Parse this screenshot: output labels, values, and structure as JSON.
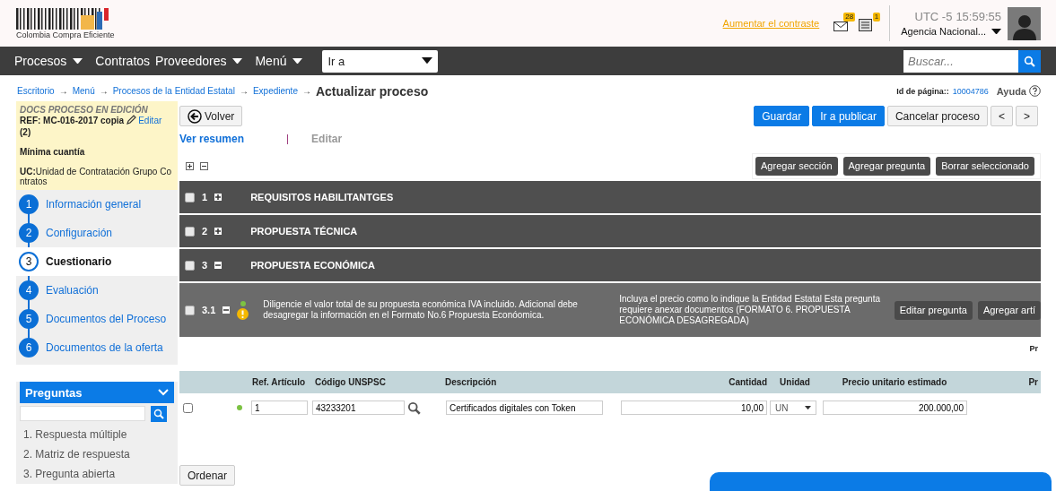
{
  "header": {
    "logo_text": "Colombia Compra Eficiente",
    "contrast_link": "Aumentar el contraste",
    "mail_count": "28",
    "news_count": "1",
    "timezone": "UTC -5",
    "time": "15:59:55",
    "agency": "Agencia Nacional..."
  },
  "nav": {
    "items": [
      {
        "label": "Procesos",
        "dropdown": true
      },
      {
        "label": "Contratos",
        "dropdown": false
      },
      {
        "label": "Proveedores",
        "dropdown": true
      },
      {
        "label": "Menú",
        "dropdown": true
      }
    ],
    "goto": "Ir a",
    "search": {
      "placeholder": "Buscar..."
    }
  },
  "breadcrumb": {
    "links": [
      {
        "label": "Escritorio",
        "arrow": "→"
      },
      {
        "label": "Menú",
        "arrow": "→"
      },
      {
        "label": "Procesos de la Entidad Estatal",
        "arrow": "→"
      },
      {
        "label": "Expediente",
        "arrow": "→"
      }
    ],
    "current": "Actualizar proceso",
    "page_id_label": "Id de página::",
    "page_id": "10004786",
    "help": "Ayuda"
  },
  "sidebar": {
    "status": "DOCS PROCESO EN EDICIÓN",
    "ref": "REF: MC-016-2017 copia",
    "edit": "Editar",
    "ref_suffix": "(2)",
    "modality": "Mínima cuantía",
    "unit": "**UC:**Unidad de Contratación Grupo Contratos",
    "steps": [
      {
        "number": "1",
        "label": "Información general",
        "selected": false
      },
      {
        "number": "2",
        "label": "Configuración",
        "selected": false
      },
      {
        "number": "3",
        "label": "Cuestionario",
        "selected": true
      },
      {
        "number": "4",
        "label": "Evaluación",
        "selected": false
      },
      {
        "number": "5",
        "label": "Documentos del Proceso",
        "selected": false
      },
      {
        "number": "6",
        "label": "Documentos de la oferta",
        "selected": false
      }
    ],
    "questions": {
      "title": "Preguntas",
      "expanded": true,
      "items": [
        {
          "number": "1.",
          "label": "Respuesta múltiple"
        },
        {
          "number": "2.",
          "label": "Matriz de respuesta"
        },
        {
          "number": "3.",
          "label": "Pregunta abierta"
        }
      ]
    }
  },
  "main": {
    "back": "Volver",
    "actions": [
      {
        "label": "Guardar",
        "kind": "primary"
      },
      {
        "label": "Ir a publicar",
        "kind": "primary"
      },
      {
        "label": "Cancelar proceso",
        "kind": "default"
      },
      {
        "label": "<",
        "kind": "default"
      },
      {
        "label": ">",
        "kind": "default"
      }
    ],
    "view_tabs": [
      {
        "label": "Ver resumen",
        "selected": true
      },
      {
        "label": "Editar",
        "selected": false
      }
    ],
    "toolbar": [
      "Agregar sección",
      "Agregar pregunta",
      "Borrar seleccionado"
    ],
    "sections": [
      {
        "number": "1",
        "title": "REQUISITOS HABILITANTGES",
        "checked": false,
        "expanded": false
      },
      {
        "number": "2",
        "title": "PROPUESTA TÉCNICA",
        "checked": false,
        "expanded": false
      },
      {
        "number": "3",
        "title": "PROPUESTA ECONÓMICA",
        "checked": false,
        "expanded": true
      }
    ],
    "question": {
      "number": "3.1",
      "checked": false,
      "expanded": true,
      "color": "#7cc242",
      "text": "Diligencie el valor total de su propuesta económica IVA incluido. Adicional debe desagregar la información en el Formato No.6 Propuesta Econóomica.",
      "note": "Incluya el precio como lo indique la Entidad Estatal Esta pregunta requiere anexar documentos (FORMATO 6. PROPUESTA ECONÓMICA DESAGREGADA)",
      "buttons": [
        "Editar pregunta",
        "Agregar artí"
      ]
    },
    "cut_label": "Pr",
    "table": {
      "columns": [
        "Ref. Artículo",
        "Código UNSPSC",
        "Descripción",
        "Cantidad",
        "Unidad",
        "Precio unitario estimado",
        "Pr"
      ],
      "rows": [
        {
          "checked": false,
          "color": "#7cc242",
          "ref": "1",
          "code": "43233201",
          "description": "Certificados digitales con Token",
          "quantity": "10,00",
          "unit": "UN",
          "price": "200.000,00"
        }
      ]
    },
    "order_button": "Ordenar"
  }
}
